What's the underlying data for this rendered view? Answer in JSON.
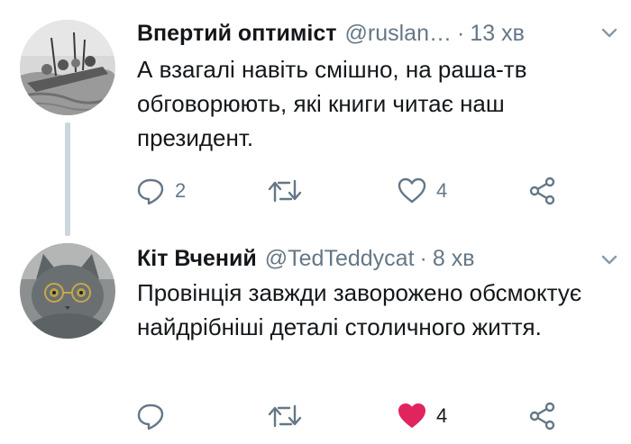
{
  "tweets": [
    {
      "author_name": "Впертий оптиміст",
      "handle": "@ruslan…",
      "separator": "·",
      "time": "13 хв",
      "text": "А взагалі навіть смішно, на раша-тв обговорюють, які книги читає наш президент.",
      "reply_count": "2",
      "retweet_count": "",
      "like_count": "4",
      "liked": false,
      "avatar_icon": "engraving-boat-avatar"
    },
    {
      "author_name": "Кіт Вчений",
      "handle": "@TedTeddycat",
      "separator": "·",
      "time": "8 хв",
      "text": "Провінція завжди заворожено обсмоктує найдрібніші деталі столичного життя.",
      "reply_count": "",
      "retweet_count": "",
      "like_count": "4",
      "liked": true,
      "avatar_icon": "grey-cat-with-glasses-avatar"
    }
  ],
  "colors": {
    "secondary_text": "#657786",
    "primary_text": "#14171a",
    "like_active": "#e0245e",
    "thread_line": "#ccd6dd"
  }
}
